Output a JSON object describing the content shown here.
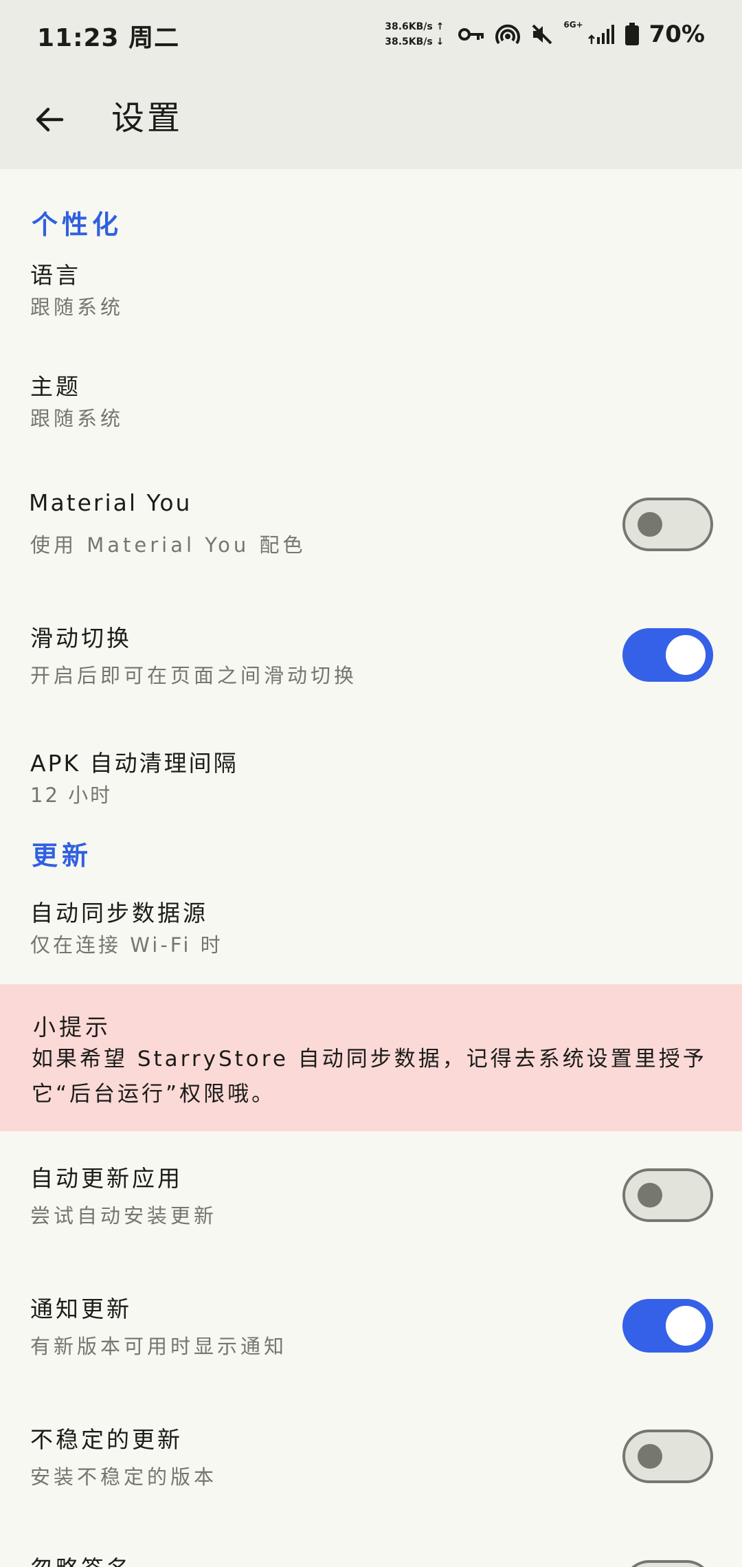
{
  "status_bar": {
    "time": "11:23 周二",
    "speed_up": "38.6KB/s ↑",
    "speed_down": "38.5KB/s ↓",
    "network_label": "6G+",
    "battery": "70%",
    "icons": [
      "key-icon",
      "hotspot-icon",
      "mute-icon",
      "signal-icon",
      "battery-icon"
    ]
  },
  "app_bar": {
    "title": "设置",
    "back_icon": "arrow-back-icon"
  },
  "colors": {
    "accent": "#3461e8",
    "section_header": "#3060e0",
    "background": "#f7f8f2",
    "app_bar": "#ebece6",
    "tip_background": "#fbd9d7",
    "summary_text": "#74776c"
  },
  "sections": {
    "personalization": {
      "header": "个性化",
      "language": {
        "title": "语言",
        "summary": "跟随系统"
      },
      "theme": {
        "title": "主题",
        "summary": "跟随系统"
      },
      "material_you": {
        "title": "Material You",
        "summary": "使用 Material You 配色",
        "enabled": false
      },
      "swipe_switch": {
        "title": "滑动切换",
        "summary": "开启后即可在页面之间滑动切换",
        "enabled": true
      },
      "apk_cleanup": {
        "title": "APK 自动清理间隔",
        "summary": "12 小时"
      }
    },
    "update": {
      "header": "更新",
      "auto_sync": {
        "title": "自动同步数据源",
        "summary": "仅在连接 Wi-Fi 时"
      },
      "tip": {
        "title": "小提示",
        "body": "如果希望 StarryStore 自动同步数据，记得去系统设置里授予它“后台运行”权限哦。"
      },
      "auto_update": {
        "title": "自动更新应用",
        "summary": "尝试自动安装更新",
        "enabled": false
      },
      "notify_update": {
        "title": "通知更新",
        "summary": "有新版本可用时显示通知",
        "enabled": true
      },
      "unstable_update": {
        "title": "不稳定的更新",
        "summary": "安装不稳定的版本",
        "enabled": false
      },
      "ignore_signature": {
        "title": "忽略签名"
      }
    }
  }
}
